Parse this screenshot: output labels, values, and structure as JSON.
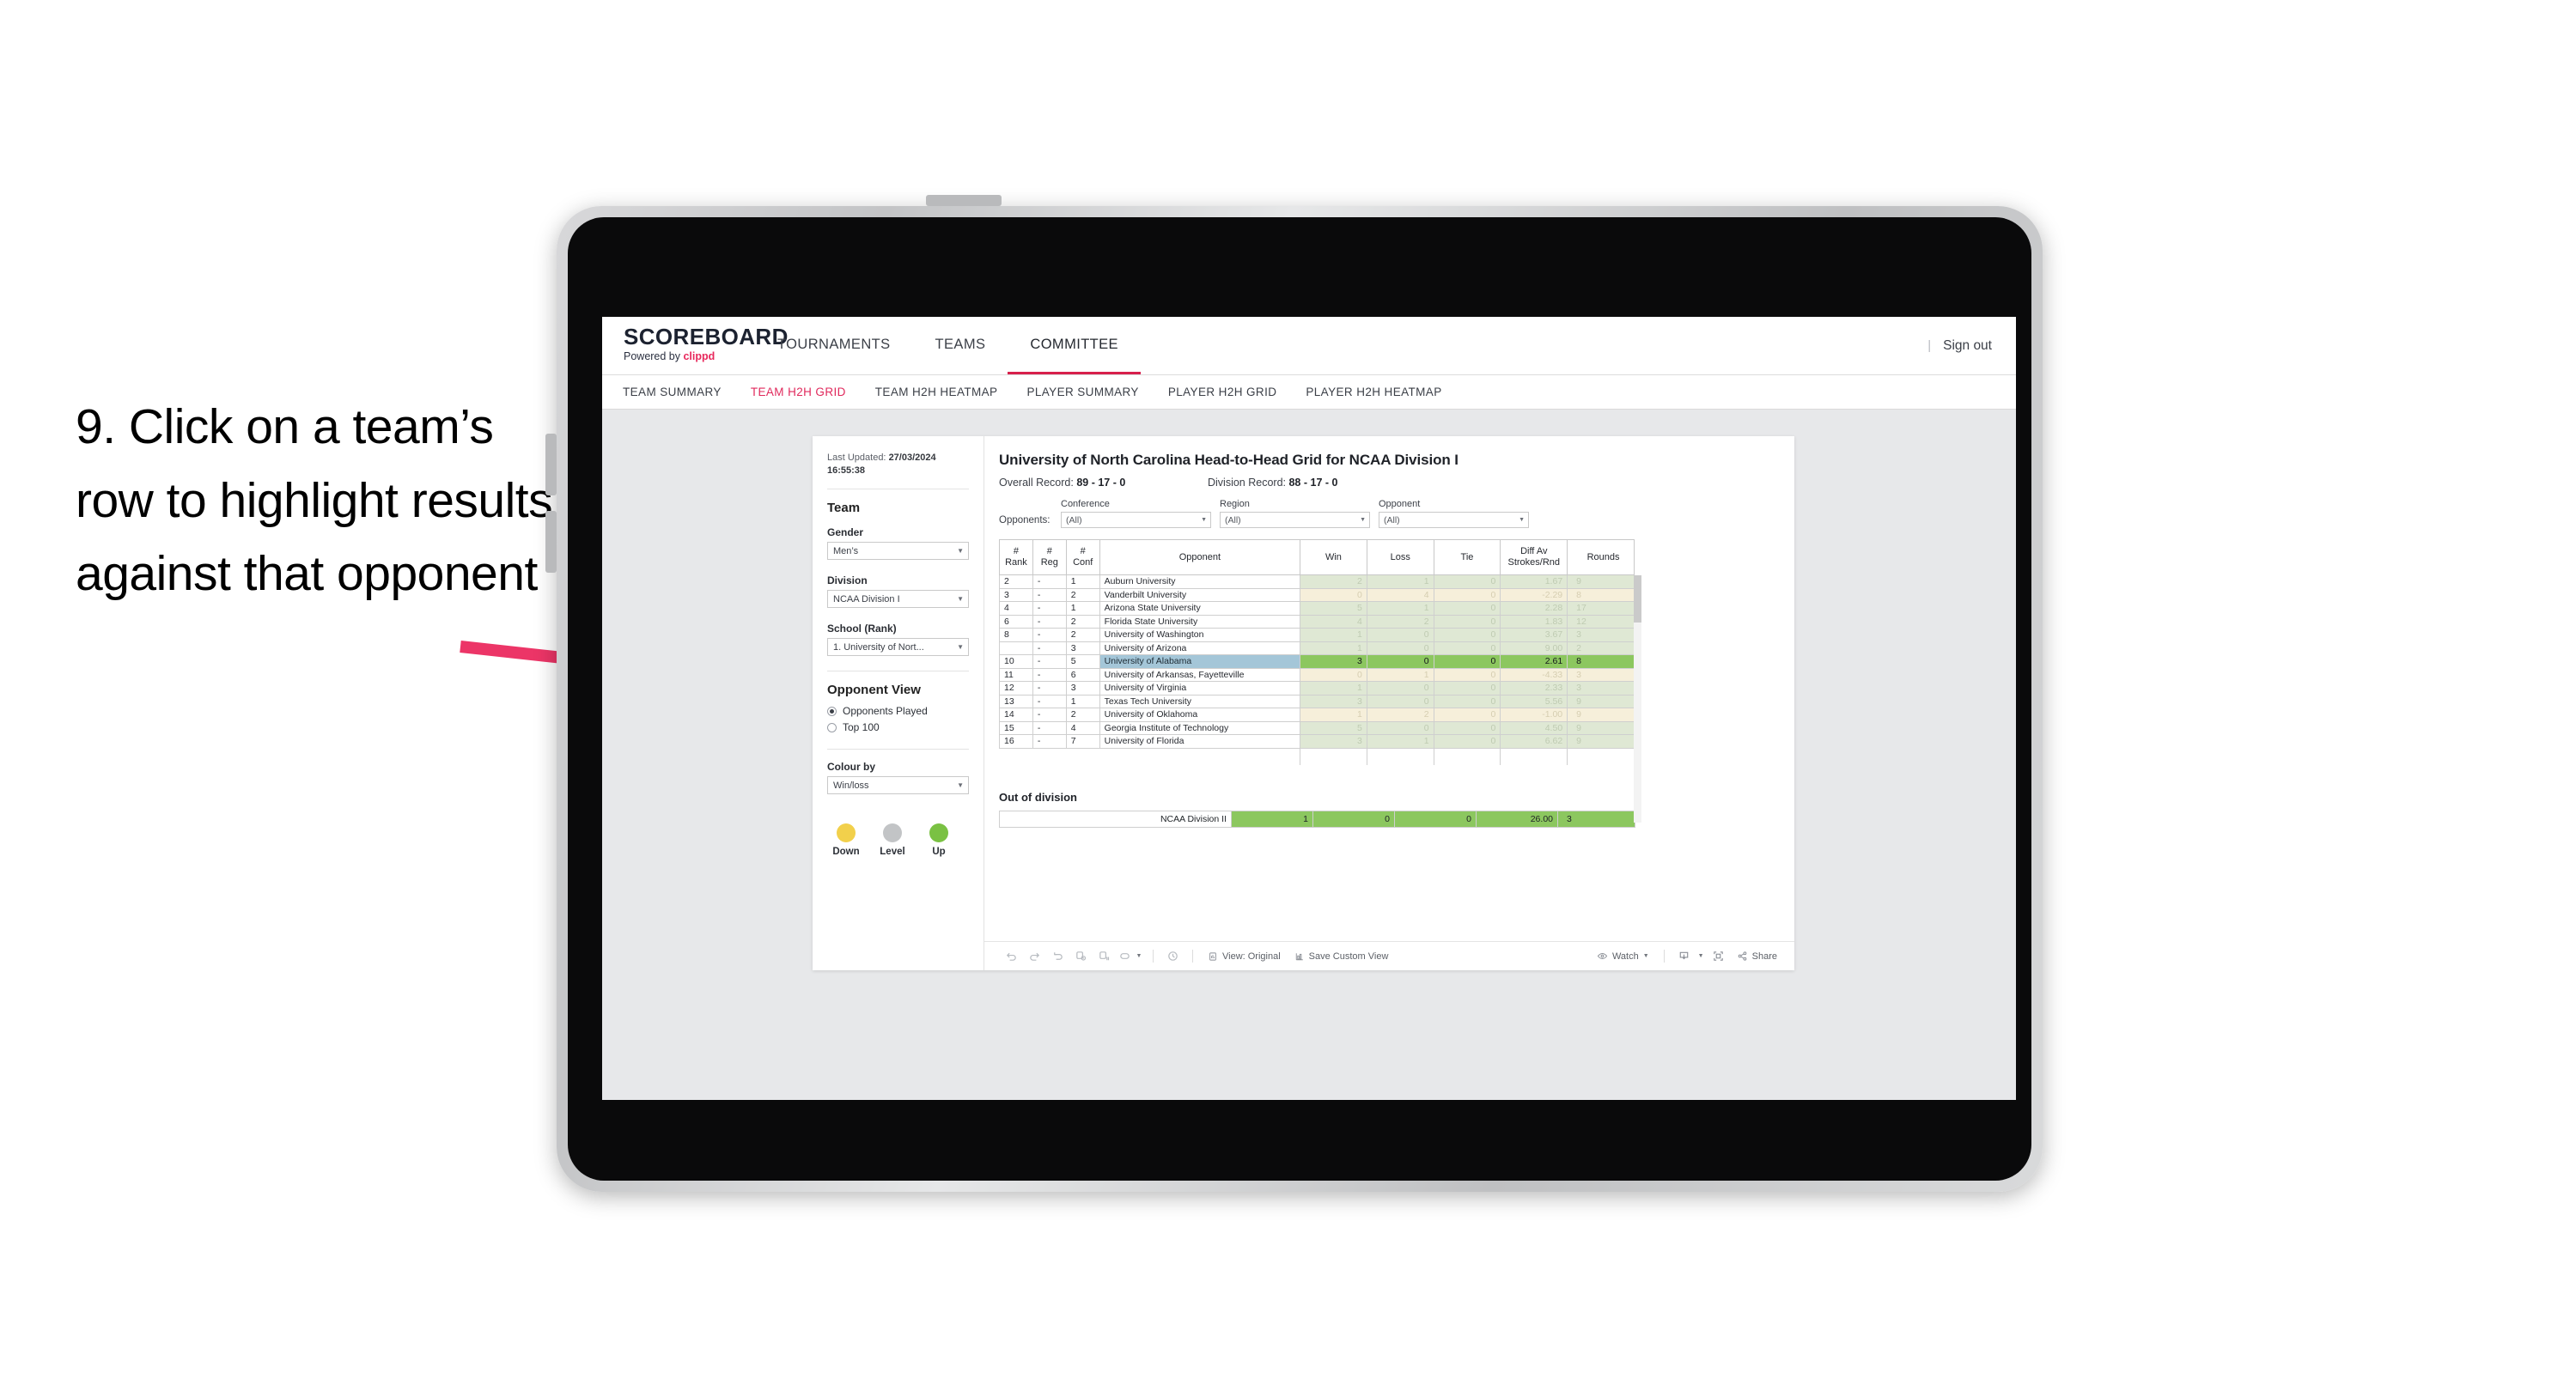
{
  "annotation": {
    "text": "9. Click on a team’s row to highlight results against that opponent",
    "arrow_color": "#ec3567"
  },
  "topnav": {
    "brand_title": "SCOREBOARD",
    "brand_powered_prefix": "Powered by ",
    "brand_powered_name": "clippd",
    "tabs": [
      {
        "label": "TOURNAMENTS",
        "active": false
      },
      {
        "label": "TEAMS",
        "active": false
      },
      {
        "label": "COMMITTEE",
        "active": true
      }
    ],
    "divider": "|",
    "sign_out": "Sign out"
  },
  "subnav": {
    "tabs": [
      {
        "label": "TEAM SUMMARY",
        "active": false
      },
      {
        "label": "TEAM H2H GRID",
        "active": true
      },
      {
        "label": "TEAM H2H HEATMAP",
        "active": false
      },
      {
        "label": "PLAYER SUMMARY",
        "active": false
      },
      {
        "label": "PLAYER H2H GRID",
        "active": false
      },
      {
        "label": "PLAYER H2H HEATMAP",
        "active": false
      }
    ]
  },
  "sidebar": {
    "last_updated_label": "Last Updated: ",
    "last_updated_value": "27/03/2024 16:55:38",
    "team_heading": "Team",
    "gender_label": "Gender",
    "gender_value": "Men’s",
    "division_label": "Division",
    "division_value": "NCAA Division I",
    "school_label": "School (Rank)",
    "school_value": "1. University of Nort...",
    "opponent_view_heading": "Opponent View",
    "opponent_view_options": [
      {
        "label": "Opponents Played",
        "selected": true
      },
      {
        "label": "Top 100",
        "selected": false
      }
    ],
    "colour_by_label": "Colour by",
    "colour_by_value": "Win/loss",
    "legend": [
      {
        "label": "Down",
        "color": "#f2d04b"
      },
      {
        "label": "Level",
        "color": "#c2c4c6"
      },
      {
        "label": "Up",
        "color": "#7ac143"
      }
    ]
  },
  "main": {
    "title": "University of North Carolina Head-to-Head Grid for NCAA Division I",
    "overall_record_label": "Overall Record: ",
    "overall_record_value": "89 - 17 - 0",
    "division_record_label": "Division Record: ",
    "division_record_value": "88 - 17 - 0",
    "opponents_label": "Opponents:",
    "filters": [
      {
        "label": "Conference",
        "value": "(All)"
      },
      {
        "label": "Region",
        "value": "(All)"
      },
      {
        "label": "Opponent",
        "value": "(All)"
      }
    ]
  },
  "table": {
    "headers": {
      "rank": "#\nRank",
      "rank_line1": "#",
      "rank_line2": "Rank",
      "reg_line1": "#",
      "reg_line2": "Reg",
      "conf_line1": "#",
      "conf_line2": "Conf",
      "opponent": "Opponent",
      "win": "Win",
      "loss": "Loss",
      "tie": "Tie",
      "diff_line1": "Diff Av",
      "diff_line2": "Strokes/Rnd",
      "rounds": "Rounds"
    },
    "rows": [
      {
        "rank": "2",
        "reg": "-",
        "conf": "1",
        "opponent": "Auburn University",
        "win": "2",
        "loss": "1",
        "tie": "0",
        "diff": "1.67",
        "rounds": "9",
        "state": "win"
      },
      {
        "rank": "3",
        "reg": "-",
        "conf": "2",
        "opponent": "Vanderbilt University",
        "win": "0",
        "loss": "4",
        "tie": "0",
        "diff": "-2.29",
        "rounds": "8",
        "state": "loss"
      },
      {
        "rank": "4",
        "reg": "-",
        "conf": "1",
        "opponent": "Arizona State University",
        "win": "5",
        "loss": "1",
        "tie": "0",
        "diff": "2.28",
        "rounds": "17",
        "state": "win"
      },
      {
        "rank": "6",
        "reg": "-",
        "conf": "2",
        "opponent": "Florida State University",
        "win": "4",
        "loss": "2",
        "tie": "0",
        "diff": "1.83",
        "rounds": "12",
        "state": "win"
      },
      {
        "rank": "8",
        "reg": "-",
        "conf": "2",
        "opponent": "University of Washington",
        "win": "1",
        "loss": "0",
        "tie": "0",
        "diff": "3.67",
        "rounds": "3",
        "state": "win"
      },
      {
        "rank": "",
        "reg": "-",
        "conf": "3",
        "opponent": "University of Arizona",
        "win": "1",
        "loss": "0",
        "tie": "0",
        "diff": "9.00",
        "rounds": "2",
        "state": "win"
      },
      {
        "rank": "10",
        "reg": "-",
        "conf": "5",
        "opponent": "University of Alabama",
        "win": "3",
        "loss": "0",
        "tie": "0",
        "diff": "2.61",
        "rounds": "8",
        "state": "selected"
      },
      {
        "rank": "11",
        "reg": "-",
        "conf": "6",
        "opponent": "University of Arkansas, Fayetteville",
        "win": "0",
        "loss": "1",
        "tie": "0",
        "diff": "-4.33",
        "rounds": "3",
        "state": "loss"
      },
      {
        "rank": "12",
        "reg": "-",
        "conf": "3",
        "opponent": "University of Virginia",
        "win": "1",
        "loss": "0",
        "tie": "0",
        "diff": "2.33",
        "rounds": "3",
        "state": "win"
      },
      {
        "rank": "13",
        "reg": "-",
        "conf": "1",
        "opponent": "Texas Tech University",
        "win": "3",
        "loss": "0",
        "tie": "0",
        "diff": "5.56",
        "rounds": "9",
        "state": "win"
      },
      {
        "rank": "14",
        "reg": "-",
        "conf": "2",
        "opponent": "University of Oklahoma",
        "win": "1",
        "loss": "2",
        "tie": "0",
        "diff": "-1.00",
        "rounds": "9",
        "state": "loss"
      },
      {
        "rank": "15",
        "reg": "-",
        "conf": "4",
        "opponent": "Georgia Institute of Technology",
        "win": "5",
        "loss": "0",
        "tie": "0",
        "diff": "4.50",
        "rounds": "9",
        "state": "win"
      },
      {
        "rank": "16",
        "reg": "-",
        "conf": "7",
        "opponent": "University of Florida",
        "win": "3",
        "loss": "1",
        "tie": "0",
        "diff": "6.62",
        "rounds": "9",
        "state": "win"
      }
    ]
  },
  "out_of_division": {
    "title": "Out of division",
    "row": {
      "name": "NCAA Division II",
      "win": "1",
      "loss": "0",
      "tie": "0",
      "diff": "26.00",
      "rounds": "3"
    }
  },
  "toolbar": {
    "view_label": "View: Original",
    "save_label": "Save Custom View",
    "watch_label": "Watch",
    "share_label": "Share"
  }
}
